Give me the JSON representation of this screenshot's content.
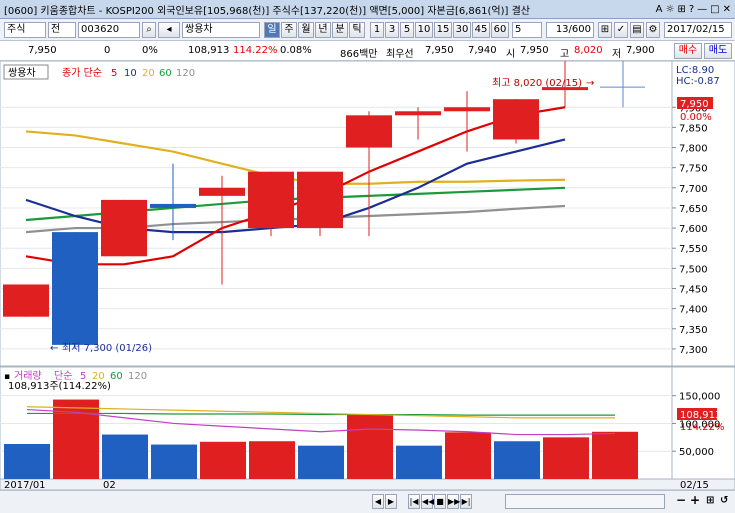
{
  "window": {
    "title": "[0600] 키움종합차트 - KOSPI200 외국인보유[105,968(천)] 주식수[137,220(천)] 액면[5,000] 자본금[6,861(억)] 결산",
    "icons": [
      "A",
      "☼",
      "⊞",
      "?",
      "—",
      "□",
      "✕"
    ]
  },
  "toolbar": {
    "market": "주식",
    "scope": "전",
    "code": "003620",
    "name": "쌍용차",
    "periods": [
      "일",
      "주",
      "월",
      "년",
      "분",
      "틱"
    ],
    "intervals": [
      "1",
      "3",
      "5",
      "10",
      "15",
      "30",
      "45",
      "60"
    ],
    "interval_value": "5",
    "count": "13/600",
    "date": "2017/02/15"
  },
  "pricebar": {
    "price": "7,950",
    "change": "0",
    "change_pct": "0%",
    "volume": "108,913",
    "vol_ratio": "114.22%",
    "turnover": "0.08%",
    "amount": "866백만",
    "best_ask_label": "최우선",
    "ask": "7,950",
    "bid": "7,940",
    "open_label": "시",
    "open": "7,950",
    "high_label": "고",
    "high": "8,020",
    "low_label": "저",
    "low": "7,900",
    "buy_label": "매수",
    "sell_label": "매도"
  },
  "price_panel": {
    "legend_name": "쌍용차",
    "ma_label": "종가 단순",
    "ma_periods": [
      "5",
      "10",
      "20",
      "60",
      "120"
    ],
    "ma_colors": [
      "#e00000",
      "#1c2e94",
      "#e0b020",
      "#1a9a3a",
      "#909090"
    ],
    "high_annotation": "최고 8,020 (02/15)",
    "low_annotation": "최저 7,300 (01/26)",
    "lc": "LC:8.90",
    "hc": "HC:-0.87",
    "current_price_tag": "7,950",
    "current_pct_tag": "0.00%",
    "y_ticks": [
      "7,900",
      "7,850",
      "7,800",
      "7,750",
      "7,700",
      "7,650",
      "7,600",
      "7,550",
      "7,500",
      "7,450",
      "7,400",
      "7,350",
      "7,300"
    ]
  },
  "volume_panel": {
    "label": "거래량",
    "ma_label": "단순",
    "ma_periods": [
      "5",
      "20",
      "60",
      "120"
    ],
    "ma_colors": [
      "#c040c0",
      "#e0b020",
      "#1a9a3a",
      "#909090"
    ],
    "current_label": "108,913주(114.22%)",
    "current_tag": "108,913",
    "current_pct_tag": "114.22%",
    "y_ticks": [
      "150,000",
      "100,000",
      "50,000"
    ]
  },
  "x_axis": {
    "labels": [
      "2017/01",
      "02"
    ],
    "right_label": "02/15"
  },
  "bottombar": {
    "nav": [
      "◀",
      "▶",
      "|◀",
      "◀◀",
      "■",
      "▶▶",
      "▶|"
    ],
    "zoom_out": "−",
    "zoom_in": "+",
    "right_btns": [
      "⊞",
      "↺"
    ]
  },
  "chart_data": {
    "type": "candlestick",
    "price": {
      "ohlc": [
        {
          "o": 7380,
          "h": 7460,
          "l": 7380,
          "c": 7460
        },
        {
          "o": 7590,
          "h": 7590,
          "l": 7300,
          "c": 7310
        },
        {
          "o": 7530,
          "h": 7670,
          "l": 7530,
          "c": 7670
        },
        {
          "o": 7660,
          "h": 7760,
          "l": 7570,
          "c": 7650
        },
        {
          "o": 7680,
          "h": 7730,
          "l": 7460,
          "c": 7700
        },
        {
          "o": 7600,
          "h": 7740,
          "l": 7580,
          "c": 7740
        },
        {
          "o": 7600,
          "h": 7740,
          "l": 7580,
          "c": 7740
        },
        {
          "o": 7800,
          "h": 7890,
          "l": 7580,
          "c": 7880
        },
        {
          "o": 7880,
          "h": 7900,
          "l": 7820,
          "c": 7890
        },
        {
          "o": 7890,
          "h": 7940,
          "l": 7790,
          "c": 7900
        },
        {
          "o": 7820,
          "h": 7920,
          "l": 7810,
          "c": 7920
        },
        {
          "o": 7950,
          "h": 8020,
          "l": 7900,
          "c": 7950
        }
      ],
      "up_color": "#e02020",
      "down_color": "#2060c0",
      "ma5": [
        7530,
        7510,
        7510,
        7530,
        7600,
        7640,
        7680,
        7740,
        7790,
        7840,
        7880,
        7900
      ],
      "ma10": [
        7670,
        7630,
        7600,
        7590,
        7590,
        7600,
        7610,
        7650,
        7700,
        7760,
        7790,
        7820
      ],
      "ma20": [
        7840,
        7830,
        7810,
        7790,
        7760,
        7730,
        7710,
        7710,
        7715,
        7715,
        7718,
        7720
      ],
      "ma60": [
        7620,
        7630,
        7640,
        7650,
        7660,
        7670,
        7675,
        7680,
        7685,
        7690,
        7695,
        7700
      ],
      "ma120": [
        7590,
        7600,
        7600,
        7610,
        7615,
        7620,
        7625,
        7630,
        7635,
        7640,
        7648,
        7655
      ],
      "ylim": [
        7270,
        7990
      ]
    },
    "volume": {
      "values": [
        63000,
        143000,
        80000,
        62000,
        67000,
        68000,
        60000,
        116000,
        60000,
        84000,
        68000,
        75000,
        85000
      ],
      "colors": [
        "#2060c0",
        "#e02020",
        "#2060c0",
        "#2060c0",
        "#e02020",
        "#e02020",
        "#2060c0",
        "#e02020",
        "#2060c0",
        "#e02020",
        "#2060c0",
        "#e02020",
        "#e02020"
      ],
      "ma5": [
        125000,
        120000,
        110000,
        100000,
        95000,
        90000,
        85000,
        90000,
        88000,
        85000,
        80000,
        80000,
        82000
      ],
      "ma20": [
        130000,
        128000,
        126000,
        124000,
        122000,
        120000,
        118000,
        116000,
        114000,
        112000,
        110000,
        110000,
        110000
      ],
      "ma60": [
        118000,
        118000,
        118000,
        117000,
        117000,
        117000,
        116000,
        116000,
        116000,
        115000,
        115000,
        115000,
        115000
      ],
      "ylim": [
        0,
        180000
      ]
    }
  }
}
